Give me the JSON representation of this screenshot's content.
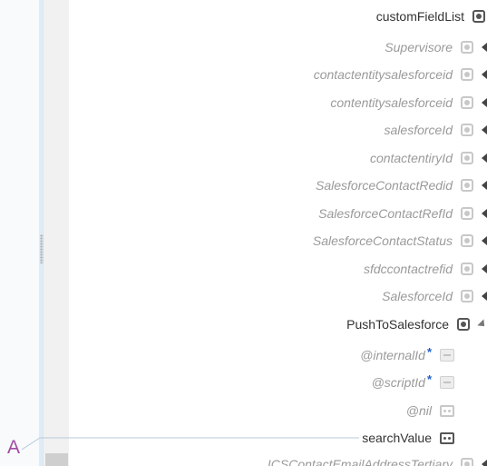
{
  "tree": {
    "parent": {
      "label": "customFieldList"
    },
    "fields": [
      {
        "label": "Supervisore"
      },
      {
        "label": "contactentitysalesforceid"
      },
      {
        "label": "contentitysalesforceid"
      },
      {
        "label": "salesforceId"
      },
      {
        "label": "contactentiryId"
      },
      {
        "label": "SalesforceContactRedid"
      },
      {
        "label": "SalesforceContactRefId"
      },
      {
        "label": "SalesforceContactStatus"
      },
      {
        "label": "sfdccontactrefid"
      },
      {
        "label": "SalesforceId"
      }
    ],
    "expanded": {
      "label": "PushToSalesforce"
    },
    "attributes": [
      {
        "label": "@internalId",
        "required": "*"
      },
      {
        "label": "@scriptId",
        "required": "*"
      },
      {
        "label": "@nil"
      }
    ],
    "mapped": {
      "label": "searchValue"
    },
    "cut_off": {
      "label": "ICSContactEmailAddressTertiary"
    }
  },
  "source_marker": {
    "label": "A",
    "color": "#a24aa5"
  }
}
